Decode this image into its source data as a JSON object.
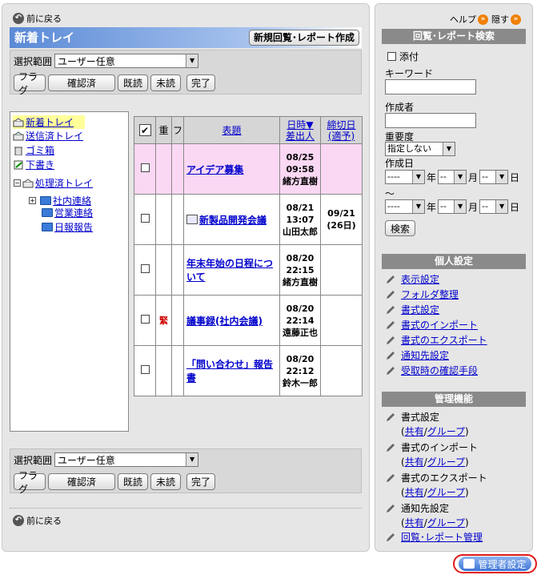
{
  "nav": {
    "back_label": "前に戻る"
  },
  "tray": {
    "title": "新着トレイ",
    "new_button": "新規回覧･レポート作成"
  },
  "filter": {
    "range_label": "選択範囲",
    "range_value": "ユーザー任意",
    "buttons": {
      "flag": "フラグ",
      "confirmed": "確認済",
      "read": "既読",
      "unread": "未読",
      "done": "完了"
    }
  },
  "folders": {
    "inbox": "新着トレイ",
    "sent": "送信済トレイ",
    "trash": "ゴミ箱",
    "draft": "下書き",
    "processed": "処理済トレイ",
    "sub": [
      "社内連絡",
      "営業連絡",
      "日報報告"
    ]
  },
  "table": {
    "headers": {
      "priority": "重",
      "attach": "フ",
      "subject": "表題",
      "date": "日時▼",
      "sender": "差出人",
      "deadline": "締切日",
      "deadline_sub": "(適予)"
    },
    "rows": [
      {
        "subject": "アイデア募集",
        "date": "08/25",
        "time": "09:58",
        "sender": "緒方直樹",
        "deadline": "",
        "deadline2": "",
        "urgent": "",
        "highlight": true
      },
      {
        "subject": "新製品開発会議",
        "date": "08/21",
        "time": "13:07",
        "sender": "山田太郎",
        "deadline": "09/21",
        "deadline2": "(26日)",
        "urgent": "",
        "icon": "memo-icon"
      },
      {
        "subject": "年末年始の日程について",
        "date": "08/20",
        "time": "22:15",
        "sender": "緒方直樹",
        "deadline": "",
        "deadline2": "",
        "urgent": ""
      },
      {
        "subject": "議事録(社内会議)",
        "date": "08/20",
        "time": "22:14",
        "sender": "遠藤正也",
        "deadline": "",
        "deadline2": "",
        "urgent": "緊"
      },
      {
        "subject": "「問い合わせ」報告書",
        "date": "08/20",
        "time": "22:12",
        "sender": "鈴木一郎",
        "deadline": "",
        "deadline2": "",
        "urgent": ""
      }
    ]
  },
  "side": {
    "help": "ヘルプ",
    "hide": "隠す",
    "search_header": "回覧･レポート検索",
    "attach_label": "添付",
    "keyword_label": "キーワード",
    "author_label": "作成者",
    "importance_label": "重要度",
    "importance_value": "指定しない",
    "created_label": "作成日",
    "date_year": "----",
    "date_md": "--",
    "year_unit": "年",
    "month_unit": "月",
    "day_unit": "日",
    "tilde": "～",
    "search_button": "検索",
    "personal_header": "個人設定",
    "personal_items": [
      "表示設定",
      "フォルダ整理",
      "書式設定",
      "書式のインポート",
      "書式のエクスポート",
      "通知先設定",
      "受取時の確認手段"
    ],
    "admin_header": "管理機能",
    "admin_items": [
      "書式設定",
      "書式のインポート",
      "書式のエクスポート",
      "通知先設定"
    ],
    "shared": "共有",
    "slash": "/",
    "group": "グループ",
    "paren_open": "(",
    "paren_close": ")",
    "report_mgmt": "回覧･レポート管理",
    "admin_button": "管理者設定"
  }
}
